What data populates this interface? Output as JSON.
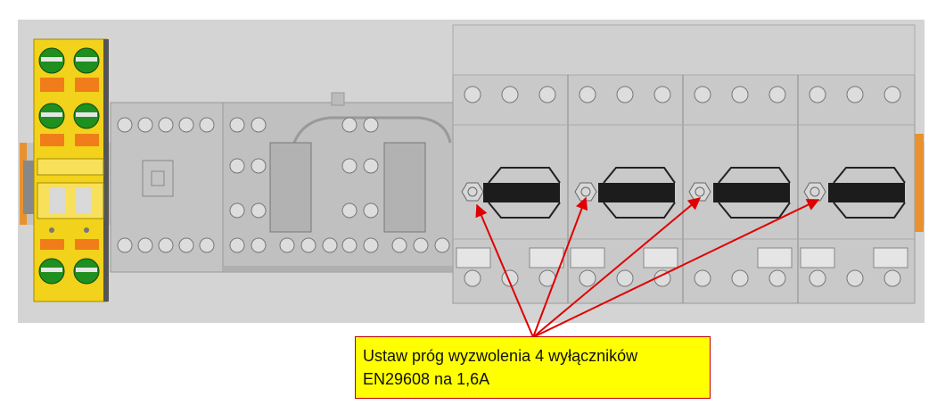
{
  "callout": {
    "line1": "Ustaw próg wyzwolenia 4 wyłączników",
    "line2": "EN29608 na 1,6A"
  },
  "colors": {
    "background_panel": "#d2d2d2",
    "device_gray": "#bdbdbd",
    "terminal_yellow": "#f2d21b",
    "terminal_green": "#1f8f1f",
    "terminal_orange": "#f07d1a",
    "arrow_red": "#e00000",
    "callout_fill": "#ffff00"
  },
  "devices": {
    "terminal_block_count": 1,
    "contactor_count": 2,
    "breaker_count": 4
  }
}
